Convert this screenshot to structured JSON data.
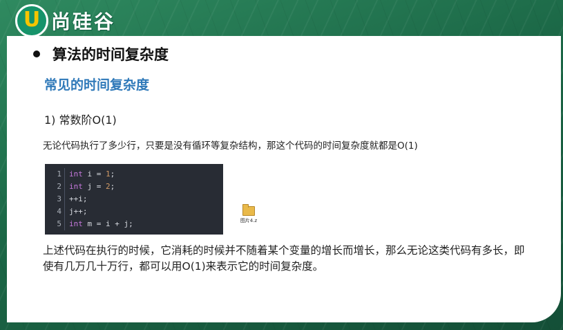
{
  "logo": {
    "mark": "U",
    "brand": "尚硅谷"
  },
  "slide": {
    "heading": "算法的时间复杂度",
    "subheading": "常见的时间复杂度",
    "item_title": "1)   常数阶O(1)",
    "description": "无论代码执行了多少行，只要是没有循环等复杂结构，那这个代码的时间复杂度就都是O(1)",
    "code": [
      {
        "num": "1",
        "kw": "int",
        "rest": " i = ",
        "val": "1",
        "end": ";"
      },
      {
        "num": "2",
        "kw": "int",
        "rest": " j = ",
        "val": "2",
        "end": ";"
      },
      {
        "num": "3",
        "kw": "",
        "rest": "++i;",
        "val": "",
        "end": ""
      },
      {
        "num": "4",
        "kw": "",
        "rest": "j++;",
        "val": "",
        "end": ""
      },
      {
        "num": "5",
        "kw": "int",
        "rest": " m = i + j;",
        "val": "",
        "end": ""
      }
    ],
    "file_icon": {
      "icon": "folder-icon",
      "label": "图片4.z"
    },
    "paragraph": "上述代码在执行的时候，它消耗的时候并不随着某个变量的增长而增长，那么无论这类代码有多长，即使有几万几十万行，都可以用O(1)来表示它的时间复杂度。"
  },
  "colors": {
    "accent_green": "#16936a",
    "logo_yellow": "#f5c400",
    "subheading_blue": "#2f79b9",
    "code_bg": "#282c34",
    "keyword": "#c678dd",
    "number": "#d19a66"
  }
}
